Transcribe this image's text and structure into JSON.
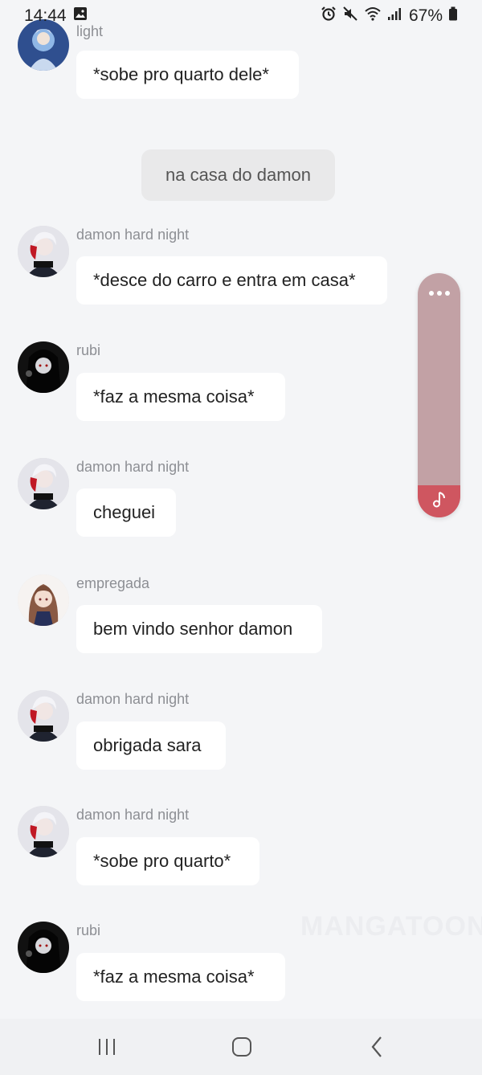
{
  "status_bar": {
    "time": "14:44",
    "battery": "67%"
  },
  "narration": "na casa do damon",
  "messages": [
    {
      "sender": "light",
      "text": "*sobe pro quarto dele*",
      "avatar": "light-avatar"
    },
    {
      "sender": "damon hard night",
      "text": "*desce do carro e entra em casa*",
      "avatar": "damon-avatar"
    },
    {
      "sender": "rubi",
      "text": "*faz a mesma coisa*",
      "avatar": "rubi-avatar"
    },
    {
      "sender": "damon hard night",
      "text": "cheguei",
      "avatar": "damon-avatar"
    },
    {
      "sender": "empregada",
      "text": "bem vindo senhor damon",
      "avatar": "empregada-avatar"
    },
    {
      "sender": "damon hard night",
      "text": "obrigada sara",
      "avatar": "damon-avatar"
    },
    {
      "sender": "damon hard night",
      "text": "*sobe pro quarto*",
      "avatar": "damon-avatar"
    },
    {
      "sender": "rubi",
      "text": "*faz a mesma coisa*",
      "avatar": "rubi-avatar"
    }
  ],
  "watermark": "MANGATOON",
  "colors": {
    "background": "#f4f5f7",
    "bubble": "#ffffff",
    "side_panel": "#c2a1a5",
    "music_button": "#cf5660"
  }
}
